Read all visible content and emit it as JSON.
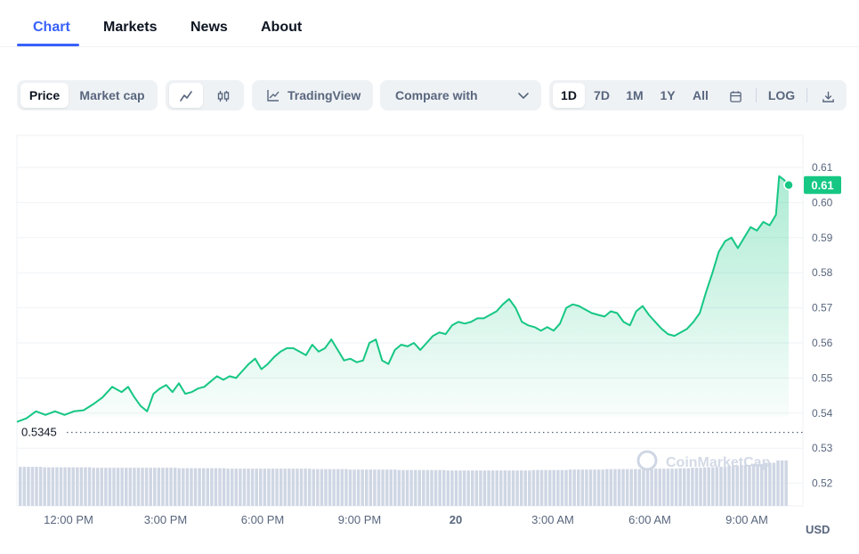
{
  "tabs": [
    {
      "label": "Chart",
      "active": true
    },
    {
      "label": "Markets",
      "active": false
    },
    {
      "label": "News",
      "active": false
    },
    {
      "label": "About",
      "active": false
    }
  ],
  "toolbar": {
    "type_toggle": [
      "Price",
      "Market cap"
    ],
    "chart_style_icons": [
      "line-chart-icon",
      "candlestick-icon"
    ],
    "tradingview_label": "TradingView",
    "compare_label": "Compare with",
    "ranges": [
      "1D",
      "7D",
      "1M",
      "1Y",
      "All"
    ],
    "active_range": "1D",
    "log_label": "LOG",
    "calendar_icon": "calendar-icon",
    "download_icon": "download-icon"
  },
  "colors": {
    "accent": "#3861fb",
    "line": "#16c784",
    "fill_top": "#16c784",
    "axis_text": "#58667e",
    "grid": "#eff2f5"
  },
  "chart_data": {
    "type": "area",
    "x_tick_labels": [
      "12:00 PM",
      "3:00 PM",
      "6:00 PM",
      "9:00 PM",
      "20",
      "3:00 AM",
      "6:00 AM",
      "9:00 AM"
    ],
    "y_tick_labels": [
      "0.61",
      "0.60",
      "0.59",
      "0.58",
      "0.57",
      "0.56",
      "0.55",
      "0.54",
      "0.53",
      "0.52"
    ],
    "ylim": [
      0.515,
      0.625
    ],
    "x_hours_range": [
      10.6,
      34.9
    ],
    "series": [
      {
        "x": [
          10.6,
          10.9,
          11.2,
          11.5,
          11.8,
          12.1,
          12.4,
          12.7,
          13.0,
          13.3,
          13.6,
          13.9,
          14.1,
          14.3,
          14.5,
          14.7,
          14.9,
          15.1,
          15.3,
          15.5,
          15.7,
          15.9,
          16.1,
          16.3,
          16.5,
          16.7,
          16.9,
          17.1,
          17.3,
          17.5,
          17.7,
          17.9,
          18.1,
          18.3,
          18.5,
          18.7,
          18.9,
          19.1,
          19.3,
          19.5,
          19.7,
          19.9,
          20.1,
          20.3,
          20.5,
          20.7,
          20.9,
          21.1,
          21.3,
          21.5,
          21.7,
          21.9,
          22.1,
          22.3,
          22.5,
          22.7,
          22.9,
          23.1,
          23.3,
          23.5,
          23.7,
          23.9,
          24.1,
          24.3,
          24.5,
          24.7,
          24.9,
          25.1,
          25.3,
          25.5,
          25.7,
          25.9,
          26.1,
          26.3,
          26.5,
          26.7,
          26.9,
          27.1,
          27.3,
          27.5,
          27.7,
          27.9,
          28.1,
          28.3,
          28.5,
          28.7,
          28.9,
          29.1,
          29.3,
          29.5,
          29.7,
          29.9,
          30.1,
          30.3,
          30.5,
          30.7,
          30.9,
          31.1,
          31.3,
          31.5,
          31.7,
          31.9,
          32.1,
          32.3,
          32.5,
          32.7,
          32.9,
          33.1,
          33.3,
          33.5,
          33.7,
          33.9,
          34.1,
          34.3,
          34.5,
          34.6,
          34.75,
          34.9
        ],
        "values": [
          0.5375,
          0.5385,
          0.5405,
          0.5395,
          0.5405,
          0.5395,
          0.5405,
          0.5408,
          0.5425,
          0.5445,
          0.5475,
          0.546,
          0.5475,
          0.5445,
          0.542,
          0.5405,
          0.5455,
          0.547,
          0.548,
          0.546,
          0.5485,
          0.5455,
          0.546,
          0.547,
          0.5475,
          0.549,
          0.5505,
          0.5495,
          0.5505,
          0.55,
          0.552,
          0.554,
          0.5555,
          0.5525,
          0.554,
          0.556,
          0.5575,
          0.5585,
          0.5585,
          0.5575,
          0.5565,
          0.5595,
          0.5575,
          0.5585,
          0.561,
          0.558,
          0.555,
          0.5555,
          0.5545,
          0.555,
          0.56,
          0.561,
          0.555,
          0.554,
          0.558,
          0.5595,
          0.559,
          0.56,
          0.558,
          0.56,
          0.562,
          0.563,
          0.5625,
          0.565,
          0.566,
          0.5655,
          0.566,
          0.567,
          0.567,
          0.568,
          0.569,
          0.571,
          0.5725,
          0.57,
          0.566,
          0.565,
          0.5645,
          0.5635,
          0.5645,
          0.5635,
          0.5655,
          0.57,
          0.571,
          0.5705,
          0.5695,
          0.5685,
          0.568,
          0.5675,
          0.569,
          0.5685,
          0.566,
          0.565,
          0.569,
          0.5705,
          0.568,
          0.566,
          0.564,
          0.5625,
          0.562,
          0.563,
          0.564,
          0.566,
          0.5685,
          0.5745,
          0.58,
          0.586,
          0.589,
          0.59,
          0.587,
          0.59,
          0.593,
          0.592,
          0.5945,
          0.5935,
          0.5965,
          0.6075,
          0.6065,
          0.605
        ]
      }
    ],
    "last_price_label": "0.61",
    "open_price_label": "0.5345",
    "open_price": 0.5345,
    "currency_label": "USD",
    "volume_relative": [
      0.86,
      0.86,
      0.85,
      0.85,
      0.85,
      0.85,
      0.84,
      0.84,
      0.84,
      0.84,
      0.84,
      0.84,
      0.84,
      0.83,
      0.83,
      0.83,
      0.83,
      0.82,
      0.82,
      0.82,
      0.82,
      0.82,
      0.82,
      0.82,
      0.81,
      0.81,
      0.81,
      0.8,
      0.8,
      0.8,
      0.8,
      0.79,
      0.79,
      0.79,
      0.79,
      0.78,
      0.78,
      0.78,
      0.78,
      0.78,
      0.78,
      0.78,
      0.79,
      0.79,
      0.79,
      0.8,
      0.8,
      0.8,
      0.81,
      0.81,
      0.81,
      0.82,
      0.82,
      0.82,
      0.83,
      0.84,
      0.85,
      0.86,
      0.88,
      0.9,
      0.92,
      0.95,
      1.0
    ],
    "watermark": "CoinMarketCap"
  }
}
